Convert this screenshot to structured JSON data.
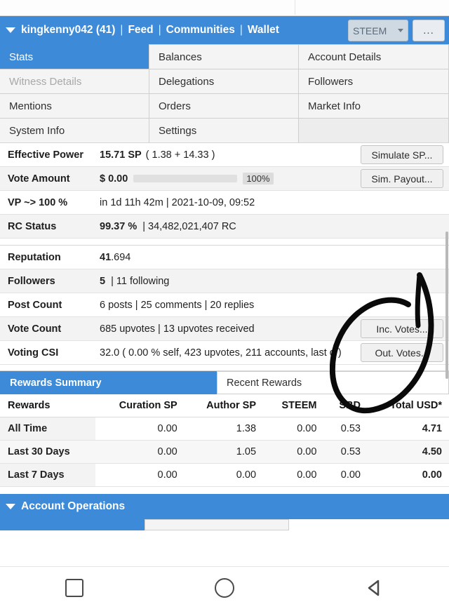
{
  "header": {
    "username": "kingkenny042 (41)",
    "nav": [
      "Feed",
      "Communities",
      "Wallet"
    ],
    "separator": "|",
    "token_select": "STEEM",
    "more_button": "...",
    "caret_icon": "caret-down-icon"
  },
  "tabs": [
    {
      "label": "Stats",
      "state": "active"
    },
    {
      "label": "Balances",
      "state": "normal"
    },
    {
      "label": "Account Details",
      "state": "normal"
    },
    {
      "label": "Witness Details",
      "state": "disabled"
    },
    {
      "label": "Delegations",
      "state": "normal"
    },
    {
      "label": "Followers",
      "state": "normal"
    },
    {
      "label": "Mentions",
      "state": "normal"
    },
    {
      "label": "Orders",
      "state": "normal"
    },
    {
      "label": "Market Info",
      "state": "normal"
    },
    {
      "label": "System Info",
      "state": "normal"
    },
    {
      "label": "Settings",
      "state": "normal"
    },
    {
      "label": "",
      "state": "blank"
    }
  ],
  "stats": {
    "group1": [
      {
        "label": "Effective Power",
        "value_strong": "15.71 SP",
        "value_rest": "( 1.38 + 14.33 )",
        "button": "Simulate SP..."
      },
      {
        "label": "Vote Amount",
        "value_strong": "$ 0.00",
        "progress_pct": "100%",
        "button": "Sim. Payout..."
      },
      {
        "label": "VP ~> 100 %",
        "value_rest": "in 1d 11h 42m  |  2021-10-09, 09:52"
      },
      {
        "label": "RC Status",
        "value_strong": "99.37 %",
        "value_rest": "|  34,482,021,407 RC"
      }
    ],
    "group2": [
      {
        "label": "Reputation",
        "value_strong": "41",
        "value_rest": ".694"
      },
      {
        "label": "Followers",
        "value_strong": "5",
        "value_rest": "|  11 following"
      },
      {
        "label": "Post Count",
        "value_rest": "6 posts  |  25 comments  |  20 replies"
      },
      {
        "label": "Vote Count",
        "value_rest": "685 upvotes  |  13 upvotes received",
        "button": "Inc. Votes..."
      },
      {
        "label": "Voting CSI",
        "value_rest": "32.0 ( 0.00 % self, 423 upvotes, 211 accounts, last d )",
        "button": "Out. Votes..."
      }
    ]
  },
  "rewards_summary": {
    "tab_active": "Rewards Summary",
    "tab_inactive": "Recent Rewards",
    "columns": [
      "Rewards",
      "Curation SP",
      "Author SP",
      "STEEM",
      "SBD",
      "Total USD*"
    ],
    "rows": [
      {
        "label": "All Time",
        "values": [
          "0.00",
          "1.38",
          "0.00",
          "0.53",
          "4.71"
        ]
      },
      {
        "label": "Last 30 Days",
        "values": [
          "0.00",
          "1.05",
          "0.00",
          "0.53",
          "4.50"
        ]
      },
      {
        "label": "Last 7 Days",
        "values": [
          "0.00",
          "0.00",
          "0.00",
          "0.00",
          "0.00"
        ]
      }
    ]
  },
  "account_operations": {
    "title": "Account Operations",
    "caret_icon": "caret-down-icon",
    "partial_row": {
      "c2": "",
      "c3": ""
    }
  },
  "navbar": {
    "recents": "square-icon",
    "home": "circle-icon",
    "back": "triangle-back-icon"
  },
  "colors": {
    "accent_blue": "#3d8ad9",
    "row_alt": "#f3f3f3",
    "annotation": "#000000"
  }
}
